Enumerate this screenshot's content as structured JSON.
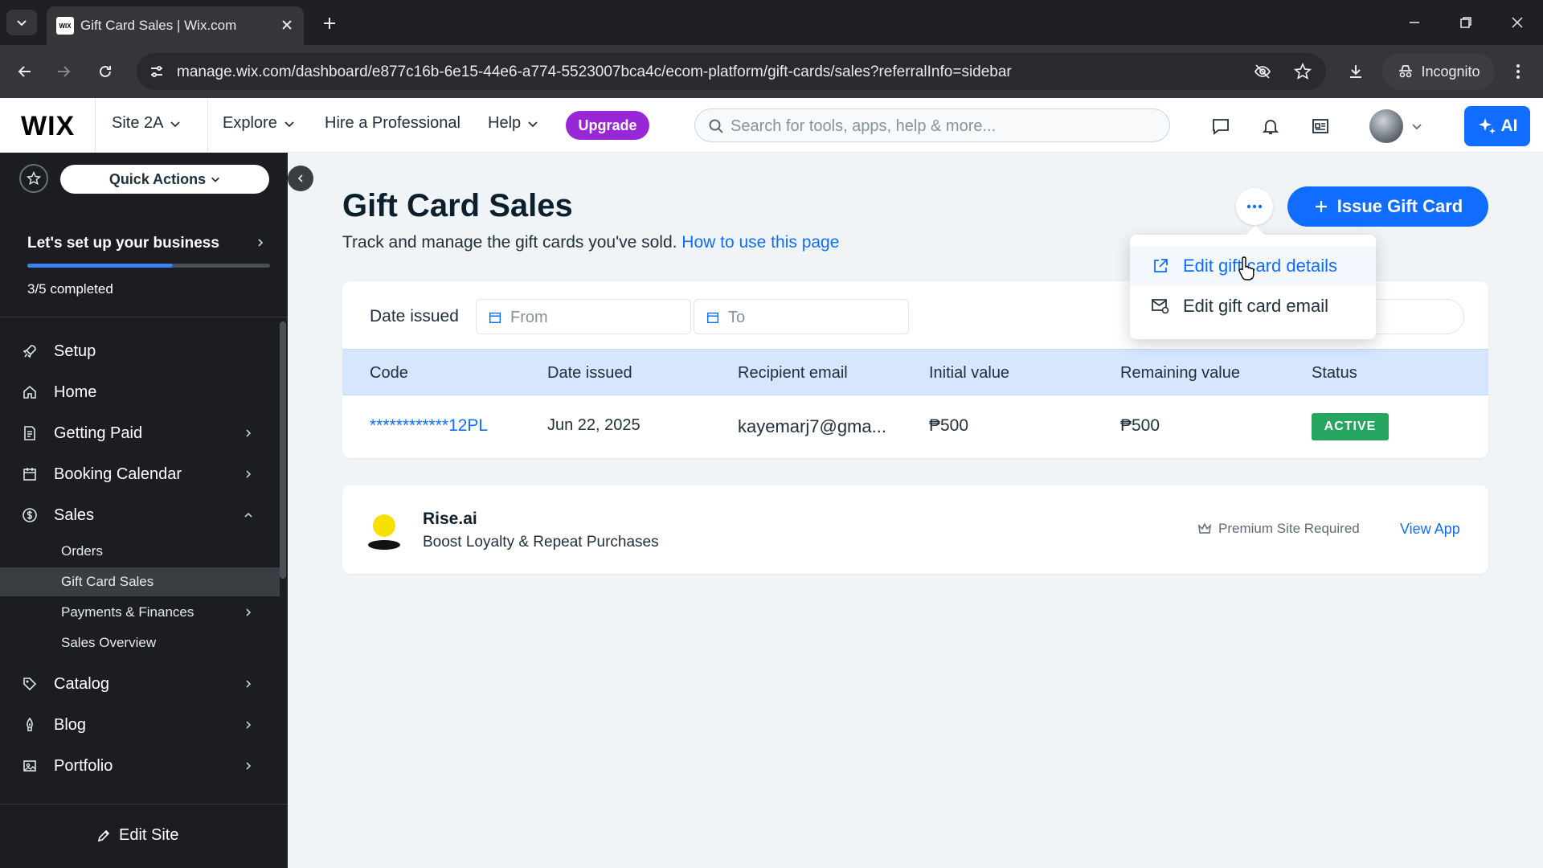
{
  "browser": {
    "tab_title": "Gift Card Sales | Wix.com",
    "url": "manage.wix.com/dashboard/e877c16b-6e15-44e6-a774-5523007bca4c/ecom-platform/gift-cards/sales?referralInfo=sidebar",
    "incognito_label": "Incognito"
  },
  "header": {
    "logo": "WIX",
    "site_name": "Site 2A",
    "explore": "Explore",
    "hire": "Hire a Professional",
    "help": "Help",
    "upgrade": "Upgrade",
    "search_placeholder": "Search for tools, apps, help & more...",
    "ai_label": "AI"
  },
  "sidebar": {
    "quick_actions": "Quick Actions",
    "setup_title": "Let's set up your business",
    "setup_progress": 0.6,
    "setup_completed": "3/5 completed",
    "items": [
      {
        "label": "Setup",
        "icon": "rocket-icon"
      },
      {
        "label": "Home",
        "icon": "home-icon"
      },
      {
        "label": "Getting Paid",
        "icon": "receipt-icon"
      },
      {
        "label": "Booking Calendar",
        "icon": "calendar-icon"
      },
      {
        "label": "Sales",
        "icon": "dollar-circle-icon"
      }
    ],
    "sales_sub": [
      {
        "label": "Orders"
      },
      {
        "label": "Gift Card Sales"
      },
      {
        "label": "Payments & Finances"
      },
      {
        "label": "Sales Overview"
      }
    ],
    "items_after": [
      {
        "label": "Catalog",
        "icon": "tag-icon"
      },
      {
        "label": "Blog",
        "icon": "pen-nib-icon"
      },
      {
        "label": "Portfolio",
        "icon": "portfolio-icon"
      }
    ],
    "edit_site": "Edit Site"
  },
  "page": {
    "title": "Gift Card Sales",
    "subtitle": "Track and manage the gift cards you've sold.",
    "help_link": "How to use this page",
    "issue_button": "Issue Gift Card",
    "filter_label": "Date issued",
    "from_placeholder": "From",
    "to_placeholder": "To",
    "columns": [
      "Code",
      "Date issued",
      "Recipient email",
      "Initial value",
      "Remaining value",
      "Status"
    ],
    "rows": [
      {
        "code": "************12PL",
        "date": "Jun 22, 2025",
        "email": "kayemarj7@gma...",
        "initial": "₱500",
        "remaining": "₱500",
        "status": "ACTIVE"
      }
    ]
  },
  "menu": {
    "items": [
      {
        "label": "Edit gift card details",
        "icon": "external-link-icon"
      },
      {
        "label": "Edit gift card email",
        "icon": "email-settings-icon"
      }
    ]
  },
  "promo": {
    "name": "Rise.ai",
    "desc": "Boost Loyalty & Repeat Purchases",
    "premium": "Premium Site Required",
    "view_app": "View App"
  },
  "colors": {
    "accent": "#116dff",
    "upgrade": "#9a27d5",
    "active": "#25a55f",
    "sidebar_bg": "#1b1d21"
  }
}
